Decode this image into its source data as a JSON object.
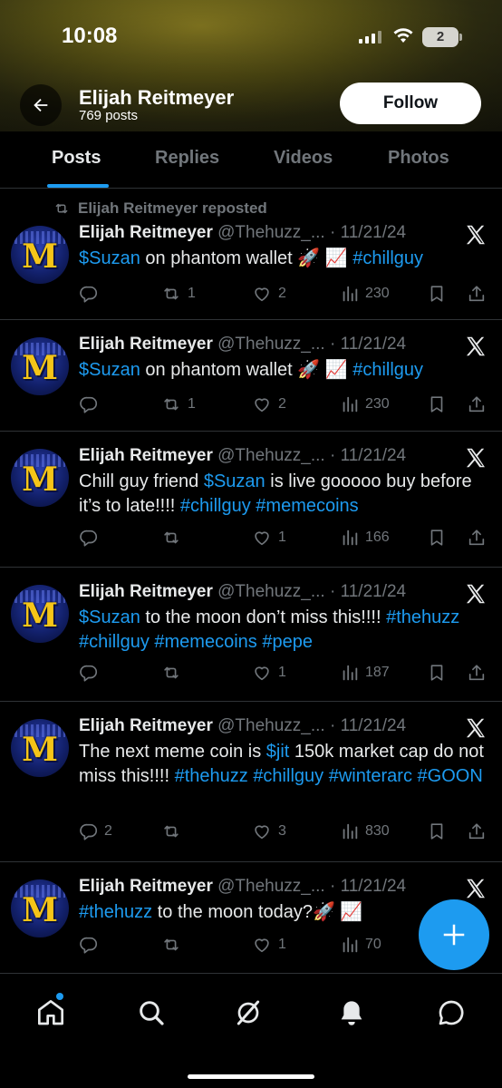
{
  "status_bar": {
    "time": "10:08",
    "battery": "2"
  },
  "header": {
    "name": "Elijah Reitmeyer",
    "post_count": "769 posts",
    "follow_label": "Follow"
  },
  "tabs": [
    {
      "label": "Posts",
      "active": true
    },
    {
      "label": "Replies",
      "active": false
    },
    {
      "label": "Videos",
      "active": false
    },
    {
      "label": "Photos",
      "active": false
    }
  ],
  "posts": [
    {
      "repost_label": "Elijah Reitmeyer reposted",
      "name": "Elijah Reitmeyer",
      "meta": "@Thehuzz_... · 11/21/24",
      "text_parts": [
        {
          "text": "$Suzan",
          "link": true
        },
        {
          "text": " on phantom wallet 🚀 📈 ",
          "link": false
        },
        {
          "text": "#chillguy",
          "link": true
        }
      ],
      "replies": "",
      "reposts": "1",
      "likes": "2",
      "views": "230"
    },
    {
      "name": "Elijah Reitmeyer",
      "meta": "@Thehuzz_... · 11/21/24",
      "text_parts": [
        {
          "text": "$Suzan",
          "link": true
        },
        {
          "text": " on phantom wallet 🚀 📈 ",
          "link": false
        },
        {
          "text": "#chillguy",
          "link": true
        }
      ],
      "replies": "",
      "reposts": "1",
      "likes": "2",
      "views": "230"
    },
    {
      "name": "Elijah Reitmeyer",
      "meta": "@Thehuzz_... · 11/21/24",
      "text_parts": [
        {
          "text": "Chill guy friend ",
          "link": false
        },
        {
          "text": "$Suzan",
          "link": true
        },
        {
          "text": " is live gooooo buy before it’s to late!!!! ",
          "link": false
        },
        {
          "text": "#chillguy",
          "link": true
        },
        {
          "text": " ",
          "link": false
        },
        {
          "text": "#memecoins",
          "link": true
        }
      ],
      "replies": "",
      "reposts": "",
      "likes": "1",
      "views": "166"
    },
    {
      "name": "Elijah Reitmeyer",
      "meta": "@Thehuzz_... · 11/21/24",
      "text_parts": [
        {
          "text": "$Suzan",
          "link": true
        },
        {
          "text": " to the moon don’t miss this!!!! ",
          "link": false
        },
        {
          "text": "#thehuzz",
          "link": true
        },
        {
          "text": " ",
          "link": false
        },
        {
          "text": "#chillguy",
          "link": true
        },
        {
          "text": " ",
          "link": false
        },
        {
          "text": "#memecoins",
          "link": true
        },
        {
          "text": " ",
          "link": false
        },
        {
          "text": "#pepe",
          "link": true
        }
      ],
      "replies": "",
      "reposts": "",
      "likes": "1",
      "views": "187"
    },
    {
      "name": "Elijah Reitmeyer",
      "meta": "@Thehuzz_... · 11/21/24",
      "text_parts": [
        {
          "text": "The next meme coin is ",
          "link": false
        },
        {
          "text": "$jit",
          "link": true
        },
        {
          "text": " 150k market cap do not miss this!!!! ",
          "link": false
        },
        {
          "text": "#thehuzz",
          "link": true
        },
        {
          "text": " ",
          "link": false
        },
        {
          "text": "#chillguy",
          "link": true
        },
        {
          "text": " ",
          "link": false
        },
        {
          "text": "#winterarc",
          "link": true
        },
        {
          "text": " ",
          "link": false
        },
        {
          "text": "#GOON",
          "link": true
        }
      ],
      "replies": "2",
      "reposts": "",
      "likes": "3",
      "views": "830"
    },
    {
      "name": "Elijah Reitmeyer",
      "meta": "@Thehuzz_... · 11/21/24",
      "text_parts": [
        {
          "text": "#thehuzz",
          "link": true
        },
        {
          "text": " to the moon today?🚀 📈",
          "link": false
        }
      ],
      "replies": "",
      "reposts": "",
      "likes": "1",
      "views": "70"
    }
  ],
  "avatar_letter": "M",
  "colors": {
    "accent": "#1d9bf0",
    "muted": "#71767b",
    "text": "#e7e9ea",
    "background": "#000000",
    "divider": "#2f3336"
  },
  "icons": {
    "back": "arrow-left-icon",
    "x_logo": "x-logo-icon",
    "reply": "reply-icon",
    "repost": "repost-icon",
    "like": "heart-icon",
    "views": "views-icon",
    "bookmark": "bookmark-icon",
    "share": "share-icon",
    "compose": "plus-icon",
    "nav": [
      "home-icon",
      "search-icon",
      "grok-icon",
      "notifications-icon",
      "messages-icon"
    ]
  }
}
